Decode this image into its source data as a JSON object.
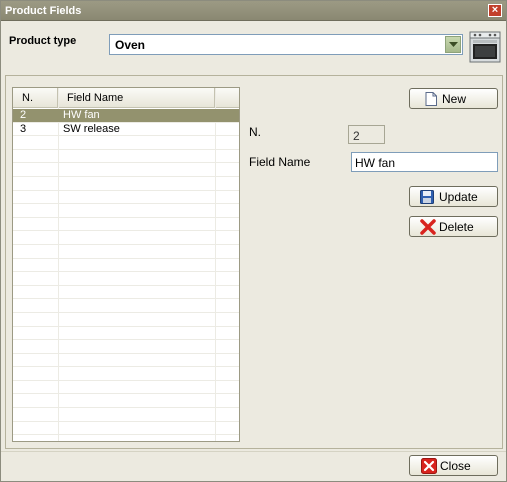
{
  "window": {
    "title": "Product Fields",
    "close_glyph": "×"
  },
  "product": {
    "label": "Product type",
    "value": "Oven",
    "icon": "oven-icon"
  },
  "grid": {
    "columns": [
      "N.",
      "Field Name"
    ],
    "rows": [
      {
        "n": "2",
        "name": "HW fan",
        "selected": true
      },
      {
        "n": "3",
        "name": "SW release",
        "selected": false
      }
    ]
  },
  "detail": {
    "n_label": "N.",
    "n_value": "2",
    "name_label": "Field Name",
    "name_value": "HW fan"
  },
  "buttons": {
    "new": "New",
    "update": "Update",
    "delete": "Delete",
    "close": "Close"
  },
  "colors": {
    "selected_row": "#93926e",
    "titlebar": "#8a8872",
    "delete_red": "#d8231e"
  }
}
